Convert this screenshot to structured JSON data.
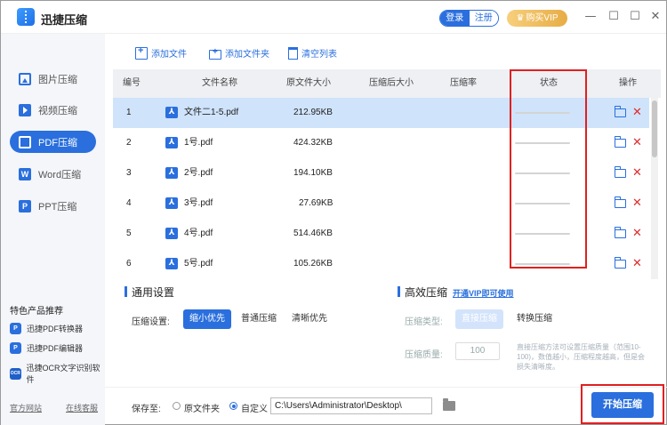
{
  "app": {
    "title": "迅捷压缩",
    "login_label": "登录",
    "register_label": "注册",
    "vip_label": "购买VIP",
    "minimize_glyph": "—",
    "maximize_glyph": "☐",
    "close_glyph": "✕"
  },
  "sidebar": {
    "items": [
      {
        "label": "图片压缩",
        "icon": "image-icon"
      },
      {
        "label": "视频压缩",
        "icon": "video-icon"
      },
      {
        "label": "PDF压缩",
        "icon": "pdf-icon",
        "active": true
      },
      {
        "label": "Word压缩",
        "icon": "word-icon",
        "glyph": "W"
      },
      {
        "label": "PPT压缩",
        "icon": "ppt-icon",
        "glyph": "P"
      }
    ],
    "featured_title": "特色产品推荐",
    "featured": [
      {
        "label": "迅捷PDF转换器",
        "glyph": "P",
        "color": "#2a6fdd"
      },
      {
        "label": "迅捷PDF编辑器",
        "glyph": "P",
        "color": "#2a6fdd"
      },
      {
        "label": "迅捷OCR文字识别软件",
        "glyph": "OCR",
        "color": "#1f5fc9"
      }
    ],
    "official_site": "官方网站",
    "online_service": "在线客服"
  },
  "toolbar": {
    "add_file": "添加文件",
    "add_folder": "添加文件夹",
    "clear_list": "清空列表"
  },
  "table": {
    "headers": {
      "index": "编号",
      "name": "文件名称",
      "original_size": "原文件大小",
      "compressed_size": "压缩后大小",
      "ratio": "压缩率",
      "status": "状态",
      "actions": "操作"
    },
    "pdf_glyph": "⅄",
    "delete_glyph": "✕",
    "rows": [
      {
        "index": "1",
        "name": "文件二1-5.pdf",
        "size": "212.95KB",
        "selected": true
      },
      {
        "index": "2",
        "name": "1号.pdf",
        "size": "424.32KB"
      },
      {
        "index": "3",
        "name": "2号.pdf",
        "size": "194.10KB"
      },
      {
        "index": "4",
        "name": "3号.pdf",
        "size": "27.69KB"
      },
      {
        "index": "5",
        "name": "4号.pdf",
        "size": "514.46KB"
      },
      {
        "index": "6",
        "name": "5号.pdf",
        "size": "105.26KB"
      }
    ]
  },
  "settings": {
    "general_title": "通用设置",
    "compress_setting_label": "压缩设置:",
    "options": [
      "缩小优先",
      "普通压缩",
      "清晰优先"
    ],
    "selected_option": "缩小优先",
    "advanced_title": "高效压缩",
    "vip_link": "开通VIP即可使用",
    "compress_type_label": "压缩类型:",
    "type_options": [
      "直接压缩",
      "转换压缩"
    ],
    "quality_label": "压缩质量:",
    "quality_value": "100",
    "hint": "直接压缩方法可设置压缩质量（范围10-100)，数值越小，压缩程度越高，但是会损失清晰度。"
  },
  "footer": {
    "save_to_label": "保存至:",
    "original_folder": "原文件夹",
    "custom": "自定义",
    "path": "C:\\Users\\Administrator\\Desktop\\",
    "start_button": "开始压缩"
  },
  "colors": {
    "accent": "#2a6fdd",
    "selected_row": "#cfe3fb",
    "highlight_box": "#e02020",
    "delete": "#e02b2b"
  }
}
